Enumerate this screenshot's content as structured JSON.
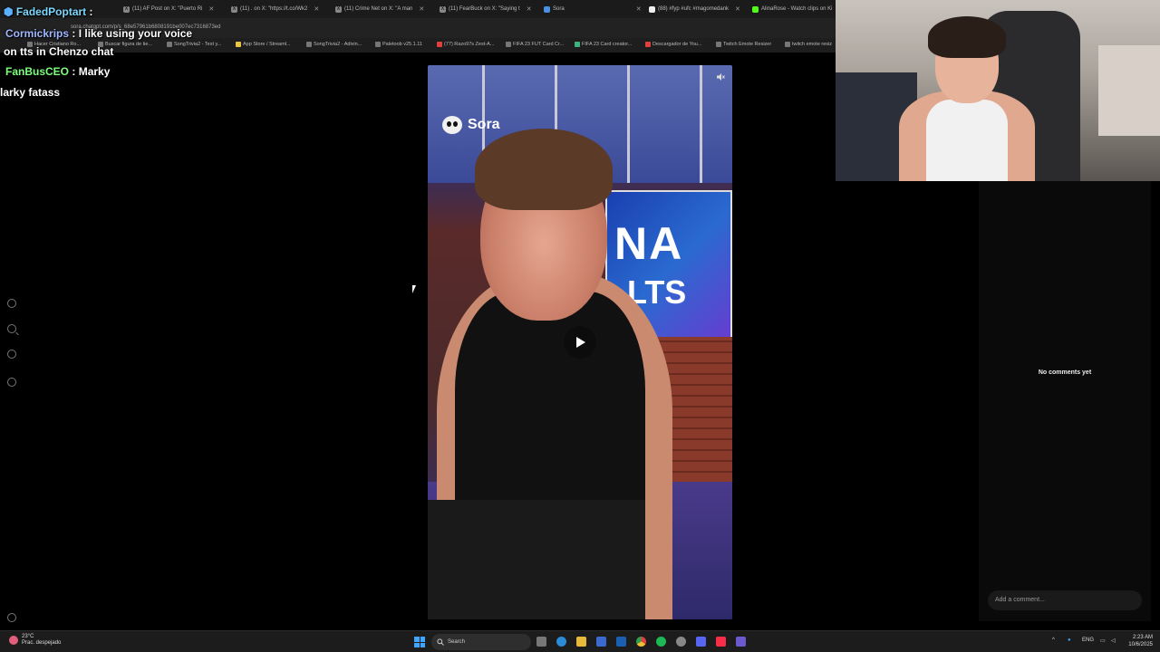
{
  "browser": {
    "tabs": [
      {
        "label": "(11) AF Post on X: \"Puerto Ri",
        "icon": "x-icon"
      },
      {
        "label": "(11) . on X: \"https://t.co/Wk2",
        "icon": "x-icon"
      },
      {
        "label": "(11) Crime Net on X: \"A man",
        "icon": "x-icon"
      },
      {
        "label": "(11) FearBuck on X: \"Saying t",
        "icon": "x-icon"
      },
      {
        "label": "Sora",
        "icon": "sora-icon"
      },
      {
        "label": "(88) #fyp #ufc #magomedank",
        "icon": "tiktok-icon"
      },
      {
        "label": "AlinaRose - Watch clips on Ki",
        "icon": "kick-icon"
      }
    ],
    "url": "sora.chatgpt.com/p/s_68e57961b6808191be007ec7316873ed",
    "bookmarks": [
      "Hacer Cristiano Ro...",
      "Buscar figura de tie...",
      "SongTrivia2 - Test y...",
      "App Store / Streaml...",
      "SongTrivia2 - Adivin...",
      "Paletoob v25.1.11",
      "(77) Razo97s Zest-A...",
      "FIFA 23 FUT Card Cr...",
      "FIFA 23 Card creator...",
      "Descargador de You...",
      "Twitch Emote Resizer",
      "twitch emote resiz"
    ]
  },
  "chat": {
    "lines": [
      {
        "user": "FadedPoptart",
        "sep": ":",
        "text": ""
      },
      {
        "user": "Cormickrips",
        "sep": ":",
        "text": "I like using your voice"
      },
      {
        "user": "",
        "sep": "",
        "text": "on tts in Chenzo chat"
      },
      {
        "user": "FanBusCEO",
        "sep": ":",
        "text": "Marky"
      },
      {
        "user": "",
        "sep": "",
        "text": "larky fatass"
      }
    ]
  },
  "video": {
    "brand": "Sora",
    "screen_text_big": "NA",
    "screen_text_small": "LTS"
  },
  "comments": {
    "empty_text": "No comments yet",
    "placeholder": "Add a comment..."
  },
  "taskbar": {
    "weather_temp": "23°C",
    "weather_desc": "Prac. despejado",
    "search_label": "Search",
    "lang": "ENG",
    "time": "2:23 AM",
    "date": "10/6/2025"
  },
  "colors": {
    "taskbar_bg": "#1c1c1c",
    "chat_user_1": "#9fb7ff",
    "chat_user_2": "#7dff7d",
    "start_blue": "#3ea6ff"
  }
}
